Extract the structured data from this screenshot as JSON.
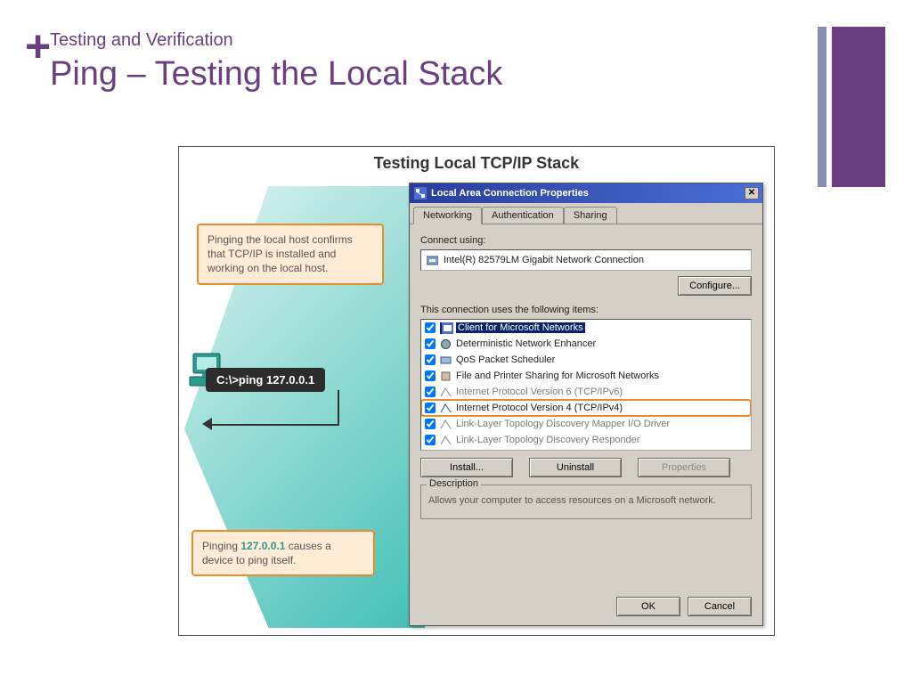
{
  "header": {
    "plus": "+",
    "eyebrow": "Testing and Verification",
    "title": "Ping – Testing the Local Stack"
  },
  "figure": {
    "title": "Testing Local TCP/IP Stack",
    "callout1": "Pinging the local host confirms that TCP/IP is installed and working on the local host.",
    "callout2_prefix": "Pinging ",
    "callout2_ip": "127.0.0.1",
    "callout2_suffix": " causes a device to ping itself.",
    "command": "C:\\>ping 127.0.0.1"
  },
  "dialog": {
    "title": "Local Area Connection Properties",
    "tabs": {
      "networking": "Networking",
      "authentication": "Authentication",
      "sharing": "Sharing"
    },
    "connect_label": "Connect using:",
    "adapter": "Intel(R) 82579LM Gigabit Network Connection",
    "configure": "Configure...",
    "items_label": "This connection uses the following items:",
    "items": [
      "Client for Microsoft Networks",
      "Deterministic Network Enhancer",
      "QoS Packet Scheduler",
      "File and Printer Sharing for Microsoft Networks",
      "Internet Protocol Version 6 (TCP/IPv6)",
      "Internet Protocol Version 4 (TCP/IPv4)",
      "Link-Layer Topology Discovery Mapper I/O Driver",
      "Link-Layer Topology Discovery Responder"
    ],
    "install": "Install...",
    "uninstall": "Uninstall",
    "properties": "Properties",
    "desc_label": "Description",
    "desc_text": "Allows your computer to access resources on a Microsoft network.",
    "ok": "OK",
    "cancel": "Cancel"
  }
}
